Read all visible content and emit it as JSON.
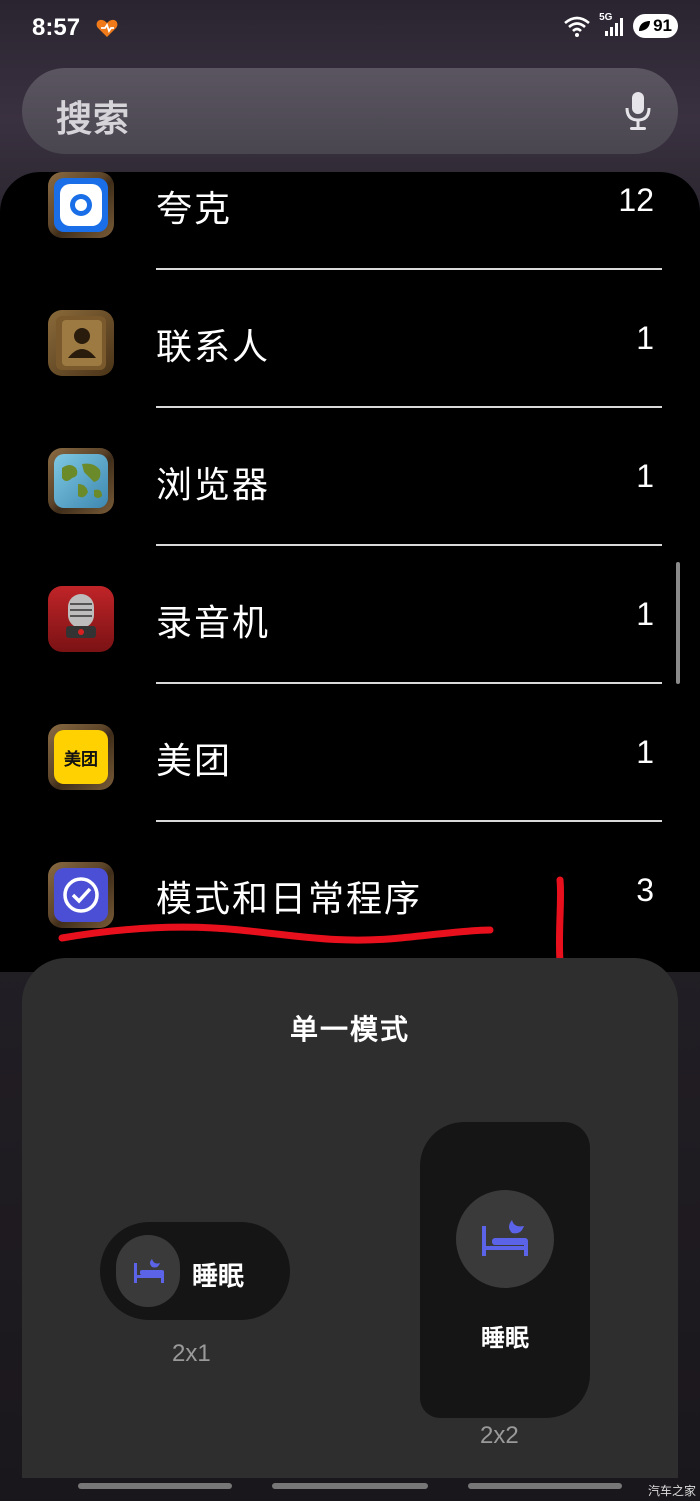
{
  "status": {
    "time": "8:57",
    "network": "5G",
    "battery": "91"
  },
  "search": {
    "placeholder": "搜索"
  },
  "apps": [
    {
      "name": "夸克",
      "count": "12",
      "icon": "quark-icon"
    },
    {
      "name": "联系人",
      "count": "1",
      "icon": "contacts-icon"
    },
    {
      "name": "浏览器",
      "count": "1",
      "icon": "browser-globe-icon"
    },
    {
      "name": "录音机",
      "count": "1",
      "icon": "recorder-mic-icon"
    },
    {
      "name": "美团",
      "count": "1",
      "icon": "meituan-icon",
      "icon_text": "美团"
    },
    {
      "name": "模式和日常程序",
      "count": "3",
      "icon": "modes-routines-icon"
    }
  ],
  "sheet": {
    "title": "单一模式",
    "widget_small": {
      "label": "睡眠",
      "size": "2x1"
    },
    "widget_large": {
      "label": "睡眠",
      "size": "2x2"
    }
  },
  "watermark": "汽车之家",
  "colors": {
    "annotation": "#e8101c",
    "bed_icon": "#5b63e8",
    "sheet_bg": "#2e2e2e"
  }
}
